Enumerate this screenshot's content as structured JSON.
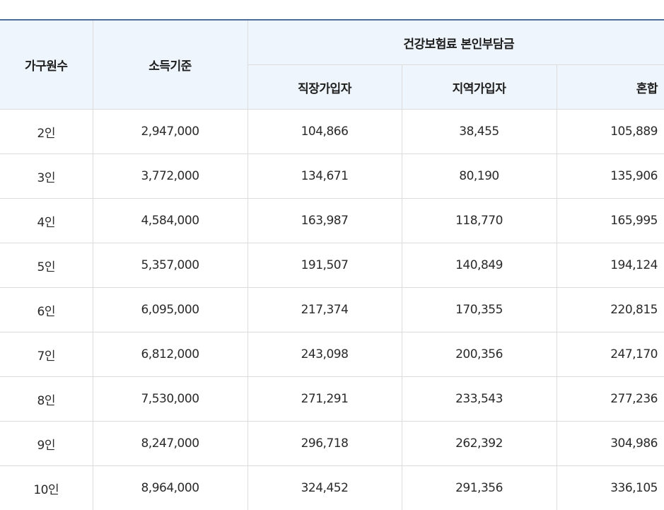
{
  "table": {
    "headers": {
      "household": "가구원수",
      "income": "소득기준",
      "premium_group": "건강보험료 본인부담금",
      "workplace": "직장가입자",
      "regional": "지역가입자",
      "mixed": "혼합"
    },
    "rows": [
      {
        "household": "2인",
        "income": "2,947,000",
        "workplace": "104,866",
        "regional": "38,455",
        "mixed": "105,889"
      },
      {
        "household": "3인",
        "income": "3,772,000",
        "workplace": "134,671",
        "regional": "80,190",
        "mixed": "135,906"
      },
      {
        "household": "4인",
        "income": "4,584,000",
        "workplace": "163,987",
        "regional": "118,770",
        "mixed": "165,995"
      },
      {
        "household": "5인",
        "income": "5,357,000",
        "workplace": "191,507",
        "regional": "140,849",
        "mixed": "194,124"
      },
      {
        "household": "6인",
        "income": "6,095,000",
        "workplace": "217,374",
        "regional": "170,355",
        "mixed": "220,815"
      },
      {
        "household": "7인",
        "income": "6,812,000",
        "workplace": "243,098",
        "regional": "200,356",
        "mixed": "247,170"
      },
      {
        "household": "8인",
        "income": "7,530,000",
        "workplace": "271,291",
        "regional": "233,543",
        "mixed": "277,236"
      },
      {
        "household": "9인",
        "income": "8,247,000",
        "workplace": "296,718",
        "regional": "262,392",
        "mixed": "304,986"
      },
      {
        "household": "10인",
        "income": "8,964,000",
        "workplace": "324,452",
        "regional": "291,356",
        "mixed": "336,105"
      }
    ]
  }
}
